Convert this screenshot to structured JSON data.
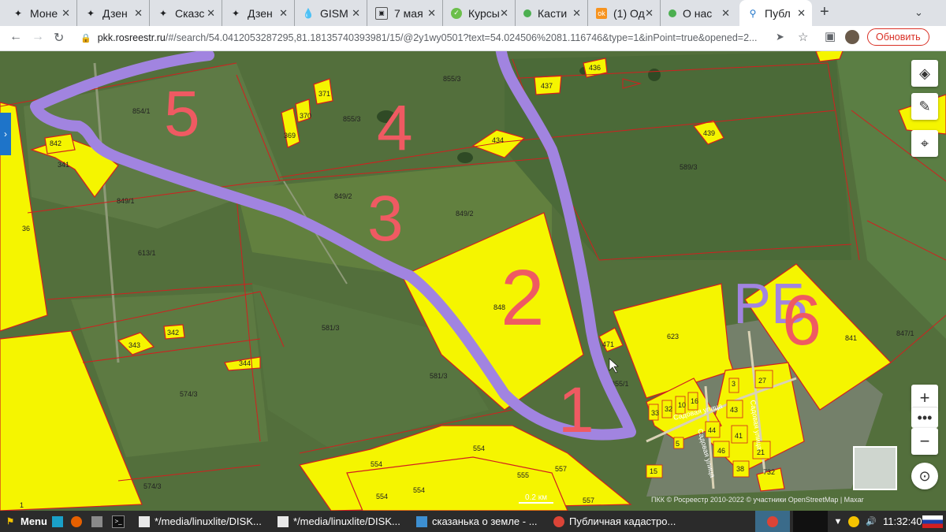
{
  "browser": {
    "tabs": [
      {
        "title": "Моне",
        "icon": "star-compass-icon"
      },
      {
        "title": "Дзен",
        "icon": "star-compass-icon"
      },
      {
        "title": "Сказс",
        "icon": "star-compass-icon"
      },
      {
        "title": "Дзен",
        "icon": "star-compass-icon"
      },
      {
        "title": "GISM",
        "icon": "drop-icon"
      },
      {
        "title": "7 мая",
        "icon": "photo-icon"
      },
      {
        "title": "Курсы",
        "icon": "check-circle-icon"
      },
      {
        "title": "Касти",
        "icon": "green-leaf-icon"
      },
      {
        "title": "(1) Од",
        "icon": "ok-icon"
      },
      {
        "title": "О нас",
        "icon": "green-leaf-icon"
      },
      {
        "title": "Публ",
        "icon": "map-pin-icon",
        "active": true
      }
    ],
    "new_tab": "+",
    "address": {
      "host": "pkk.rosreestr.ru",
      "path": "/#/search/54.0412053287295,81.18135740393981/15/@2y1wy0501?text=54.024506%2081.116746&type=1&inPoint=true&opened=2..."
    },
    "update_button": "Обновить",
    "accent_color": "#d93025"
  },
  "map": {
    "plots": [
      "854/1",
      "855/3",
      "855/3",
      "855/1",
      "849/2",
      "849/2",
      "849/1",
      "842",
      "341",
      "36",
      "613/1",
      "370",
      "371",
      "369",
      "436",
      "437",
      "434",
      "439",
      "589/3",
      "848",
      "623",
      "471",
      "841",
      "847/1",
      "581/3",
      "581/3",
      "574/3",
      "574/3",
      "342",
      "343",
      "344",
      "554",
      "554",
      "554",
      "554",
      "555",
      "557",
      "557",
      "732",
      "1",
      "33",
      "32",
      "10",
      "16",
      "43",
      "41",
      "27",
      "44",
      "46",
      "15",
      "38",
      "21",
      "3",
      "5"
    ],
    "street_labels": [
      "Садовая улица",
      "Садовая улица",
      "Садовая улица"
    ],
    "drawn_numbers": [
      "5",
      "4",
      "3",
      "2",
      "1",
      "6"
    ],
    "drawn_letters": "РБ",
    "scale_label": "0.2 км",
    "attribution": "ПКК © Росреестр 2010-2022 © участники OpenStreetMap | Maxar",
    "controls": [
      "layers-icon",
      "ruler-icon",
      "locate-icon",
      "zoom-in-icon",
      "more-icon",
      "zoom-out-icon",
      "compass-icon"
    ],
    "colors": {
      "plot_fill": "#f5f500",
      "plot_border": "#d21f1f",
      "marker_purple": "#a184e0",
      "marker_red": "#ef5a62"
    }
  },
  "taskbar": {
    "menu": "Menu",
    "items": [
      "*/media/linuxlite/DISK...",
      "*/media/linuxlite/DISK...",
      "сказанька о земле - ...",
      "Публичная кадастро..."
    ],
    "clock": "11:32:40"
  }
}
